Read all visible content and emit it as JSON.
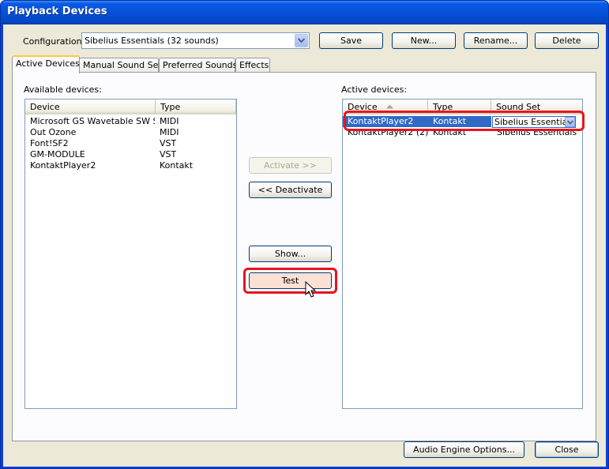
{
  "window": {
    "title": "Playback Devices"
  },
  "configuration": {
    "label": "Configuration:",
    "selected": "Sibelius Essentials (32 sounds)",
    "buttons": {
      "save": "Save",
      "new": "New...",
      "rename": "Rename...",
      "delete": "Delete"
    }
  },
  "tabs": [
    {
      "label": "Active Devices",
      "active": true
    },
    {
      "label": "Manual Sound Sets",
      "active": false
    },
    {
      "label": "Preferred Sounds",
      "active": false
    },
    {
      "label": "Effects",
      "active": false
    }
  ],
  "available": {
    "label": "Available devices:",
    "columns": [
      "Device",
      "Type"
    ],
    "rows": [
      {
        "device": "Microsoft GS Wavetable SW S...",
        "type": "MIDI"
      },
      {
        "device": "Out Ozone",
        "type": "MIDI"
      },
      {
        "device": "Font!SF2",
        "type": "VST"
      },
      {
        "device": "GM-MODULE",
        "type": "VST"
      },
      {
        "device": "KontaktPlayer2",
        "type": "Kontakt"
      }
    ]
  },
  "middle_buttons": {
    "activate": "Activate >>",
    "deactivate": "<< Deactivate",
    "show": "Show...",
    "test": "Test"
  },
  "active": {
    "label": "Active devices:",
    "columns": [
      "Device",
      "Type",
      "Sound Set"
    ],
    "rows": [
      {
        "device": "KontaktPlayer2",
        "type": "Kontakt",
        "sound_set": "Sibelius Essentials",
        "selected": true
      },
      {
        "device": "KontaktPlayer2 (2)",
        "type": "Kontakt",
        "sound_set": "Sibelius Essentials",
        "selected": false
      }
    ]
  },
  "bottom_buttons": {
    "audio_engine": "Audio Engine Options...",
    "close": "Close"
  },
  "colors": {
    "titlebar": "#0550d8",
    "dialog_bg": "#ece9d8",
    "selection": "#316ac5",
    "highlight": "#e8141c"
  }
}
